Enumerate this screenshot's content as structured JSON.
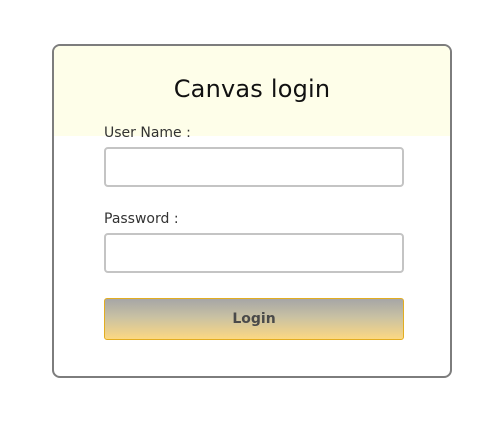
{
  "login": {
    "title": "Canvas login",
    "username_label": "User Name :",
    "username_value": "",
    "password_label": "Password :",
    "password_value": "",
    "login_button_label": "Login"
  },
  "colors": {
    "header_background": "#fefee9",
    "button_border": "#e2ad21",
    "button_gradient_top": "#a6a6a6",
    "button_gradient_bottom": "#fcd882",
    "card_border": "#7d7d7d"
  }
}
